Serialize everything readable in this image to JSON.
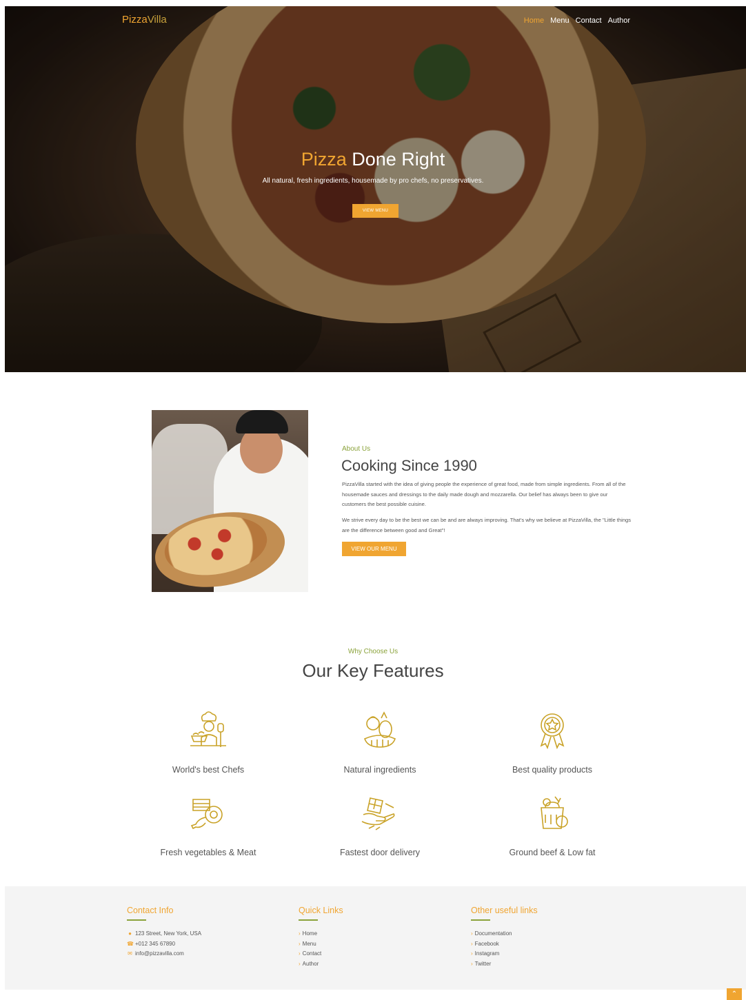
{
  "brand": {
    "part1": "Pizza",
    "part2": "Villa"
  },
  "nav": {
    "items": [
      {
        "label": "Home",
        "active": true
      },
      {
        "label": "Menu",
        "active": false
      },
      {
        "label": "Contact",
        "active": false
      },
      {
        "label": "Author",
        "active": false
      }
    ]
  },
  "hero": {
    "title_highlight": "Pizza",
    "title_rest": " Done Right",
    "subtitle": "All natural, fresh ingredients, housemade by pro chefs, no preservatives.",
    "button": "VIEW MENU"
  },
  "about": {
    "eyebrow": "About Us",
    "title": "Cooking Since 1990",
    "paragraph1": "PizzaVilla started with the idea of giving people the experience of great food, made from simple ingredients. From all of the housemade sauces and dressings to the daily made dough and mozzarella. Our belief has always been to give our customers the best possible cuisine.",
    "paragraph2": "We strive every day to be the best we can be and are always improving. That's why we believe at PizzaVilla, the \"Little things are the difference between good and Great\"!",
    "button": "VIEW OUR MENU"
  },
  "features": {
    "eyebrow": "Why Choose Us",
    "title": "Our Key Features",
    "items": [
      {
        "label": "World's best Chefs",
        "icon": "chef-icon"
      },
      {
        "label": "Natural ingredients",
        "icon": "vegetables-icon"
      },
      {
        "label": "Best quality products",
        "icon": "award-badge-icon"
      },
      {
        "label": "Fresh vegetables & Meat",
        "icon": "meat-icon"
      },
      {
        "label": "Fastest door delivery",
        "icon": "delivery-icon"
      },
      {
        "label": "Ground beef & Low fat",
        "icon": "grocery-icon"
      }
    ]
  },
  "footer": {
    "contact": {
      "heading": "Contact Info",
      "address": "123 Street, New York, USA",
      "phone": "+012 345 67890",
      "email": "info@pizzavilla.com"
    },
    "quick_links": {
      "heading": "Quick Links",
      "items": [
        "Home",
        "Menu",
        "Contact",
        "Author"
      ]
    },
    "other_links": {
      "heading": "Other useful links",
      "items": [
        "Documentation",
        "Facebook",
        "Instagram",
        "Twitter"
      ]
    }
  },
  "colors": {
    "accent": "#f0a531",
    "green": "#8aa23a",
    "icon": "#c9a227"
  }
}
